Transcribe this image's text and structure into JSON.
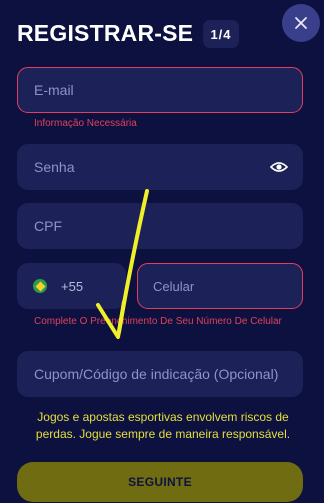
{
  "header": {
    "title": "REGISTRAR-SE",
    "step": "1/4"
  },
  "form": {
    "email": {
      "placeholder": "E-mail",
      "error": "Informação Necessária"
    },
    "password": {
      "placeholder": "Senha"
    },
    "cpf": {
      "placeholder": "CPF"
    },
    "phone": {
      "country_code": "+55",
      "placeholder": "Celular",
      "error": "Complete O Preenchimento De Seu Número De Celular"
    },
    "coupon": {
      "placeholder": "Cupom/Código de indicação (Opcional)"
    }
  },
  "disclaimer": "Jogos e apostas esportivas envolvem riscos de perdas. Jogue sempre de maneira responsável.",
  "submit_label": "SEGUINTE",
  "icons": {
    "close": "close-icon",
    "password_visibility": "eye-icon",
    "country_flag": "brazil-flag-icon"
  },
  "colors": {
    "background": "#0d1140",
    "field": "#1c2157",
    "error": "#e0405e",
    "accent": "#e6df3b",
    "button": "#6f6c12"
  }
}
